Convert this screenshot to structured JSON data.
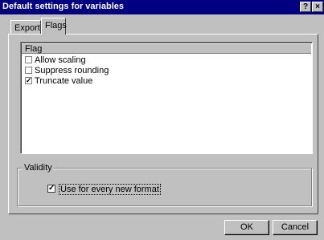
{
  "window": {
    "title": "Default settings for variables",
    "help_button": "?",
    "close_button": "×"
  },
  "tabs": [
    {
      "label": "Export"
    },
    {
      "label": "Flags"
    }
  ],
  "flags_list": {
    "header": "Flag",
    "items": [
      {
        "label": "Allow scaling",
        "checked": false
      },
      {
        "label": "Suppress rounding",
        "checked": false
      },
      {
        "label": "Truncate value",
        "checked": true
      }
    ]
  },
  "validity": {
    "group_label": "Validity",
    "use_for_every_new_format_label": "Use for every new format",
    "use_for_every_new_format_checked": true
  },
  "buttons": {
    "ok": "OK",
    "cancel": "Cancel"
  },
  "check_mark": "✓"
}
